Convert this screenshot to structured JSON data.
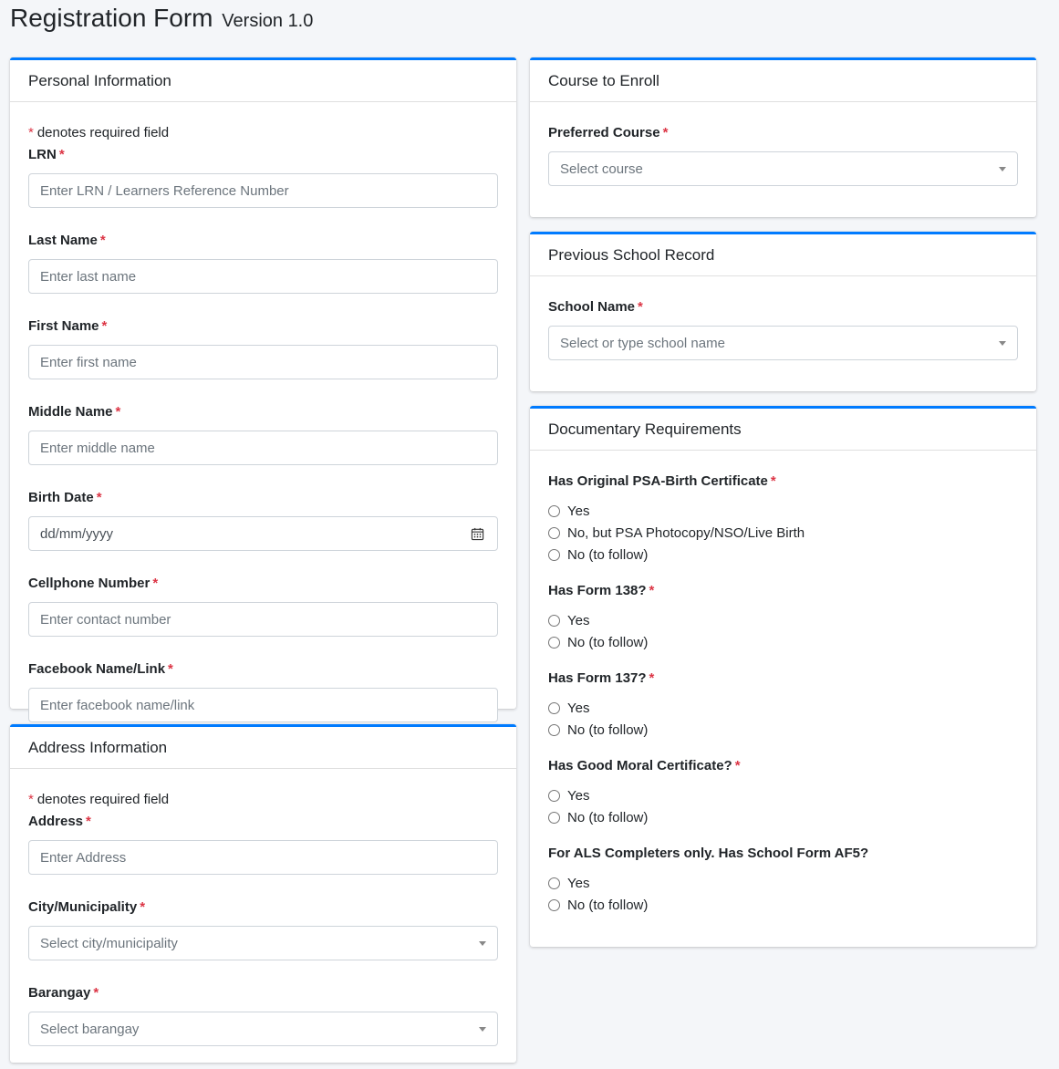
{
  "header": {
    "title": "Registration Form",
    "version": "Version 1.0"
  },
  "personal": {
    "title": "Personal Information",
    "required_note": "denotes required field",
    "fields": [
      {
        "label": "LRN",
        "placeholder": "Enter LRN / Learners Reference Number"
      },
      {
        "label": "Last Name",
        "placeholder": "Enter last name"
      },
      {
        "label": "First Name",
        "placeholder": "Enter first name"
      },
      {
        "label": "Middle Name",
        "placeholder": "Enter middle name"
      },
      {
        "label": "Birth Date",
        "placeholder": "dd/mm/yyyy"
      },
      {
        "label": "Cellphone Number",
        "placeholder": "Enter contact number"
      },
      {
        "label": "Facebook Name/Link",
        "placeholder": "Enter facebook name/link"
      }
    ]
  },
  "address": {
    "title": "Address Information",
    "required_note": "denotes required field",
    "fields": [
      {
        "label": "Address",
        "placeholder": "Enter Address"
      },
      {
        "label": "City/Municipality",
        "placeholder": "Select city/municipality"
      },
      {
        "label": "Barangay",
        "placeholder": "Select barangay"
      }
    ]
  },
  "course": {
    "title": "Course to Enroll",
    "label": "Preferred Course",
    "placeholder": "Select course"
  },
  "school": {
    "title": "Previous School Record",
    "label": "School Name",
    "placeholder": "Select or type school name"
  },
  "documents": {
    "title": "Documentary Requirements",
    "questions": [
      {
        "label": "Has Original PSA-Birth Certificate",
        "options": [
          "Yes",
          "No, but PSA Photocopy/NSO/Live Birth",
          "No (to follow)"
        ]
      },
      {
        "label": "Has Form 138?",
        "options": [
          "Yes",
          "No (to follow)"
        ]
      },
      {
        "label": "Has Form 137?",
        "options": [
          "Yes",
          "No (to follow)"
        ]
      },
      {
        "label": "Has Good Moral Certificate?",
        "options": [
          "Yes",
          "No (to follow)"
        ]
      },
      {
        "label": "For ALS Completers only. Has School Form AF5?",
        "options": [
          "Yes",
          "No (to follow)"
        ]
      }
    ]
  },
  "required_marker": "*",
  "colors": {
    "accent": "#007bff",
    "required": "#dc3545",
    "background": "#f4f6f9"
  }
}
